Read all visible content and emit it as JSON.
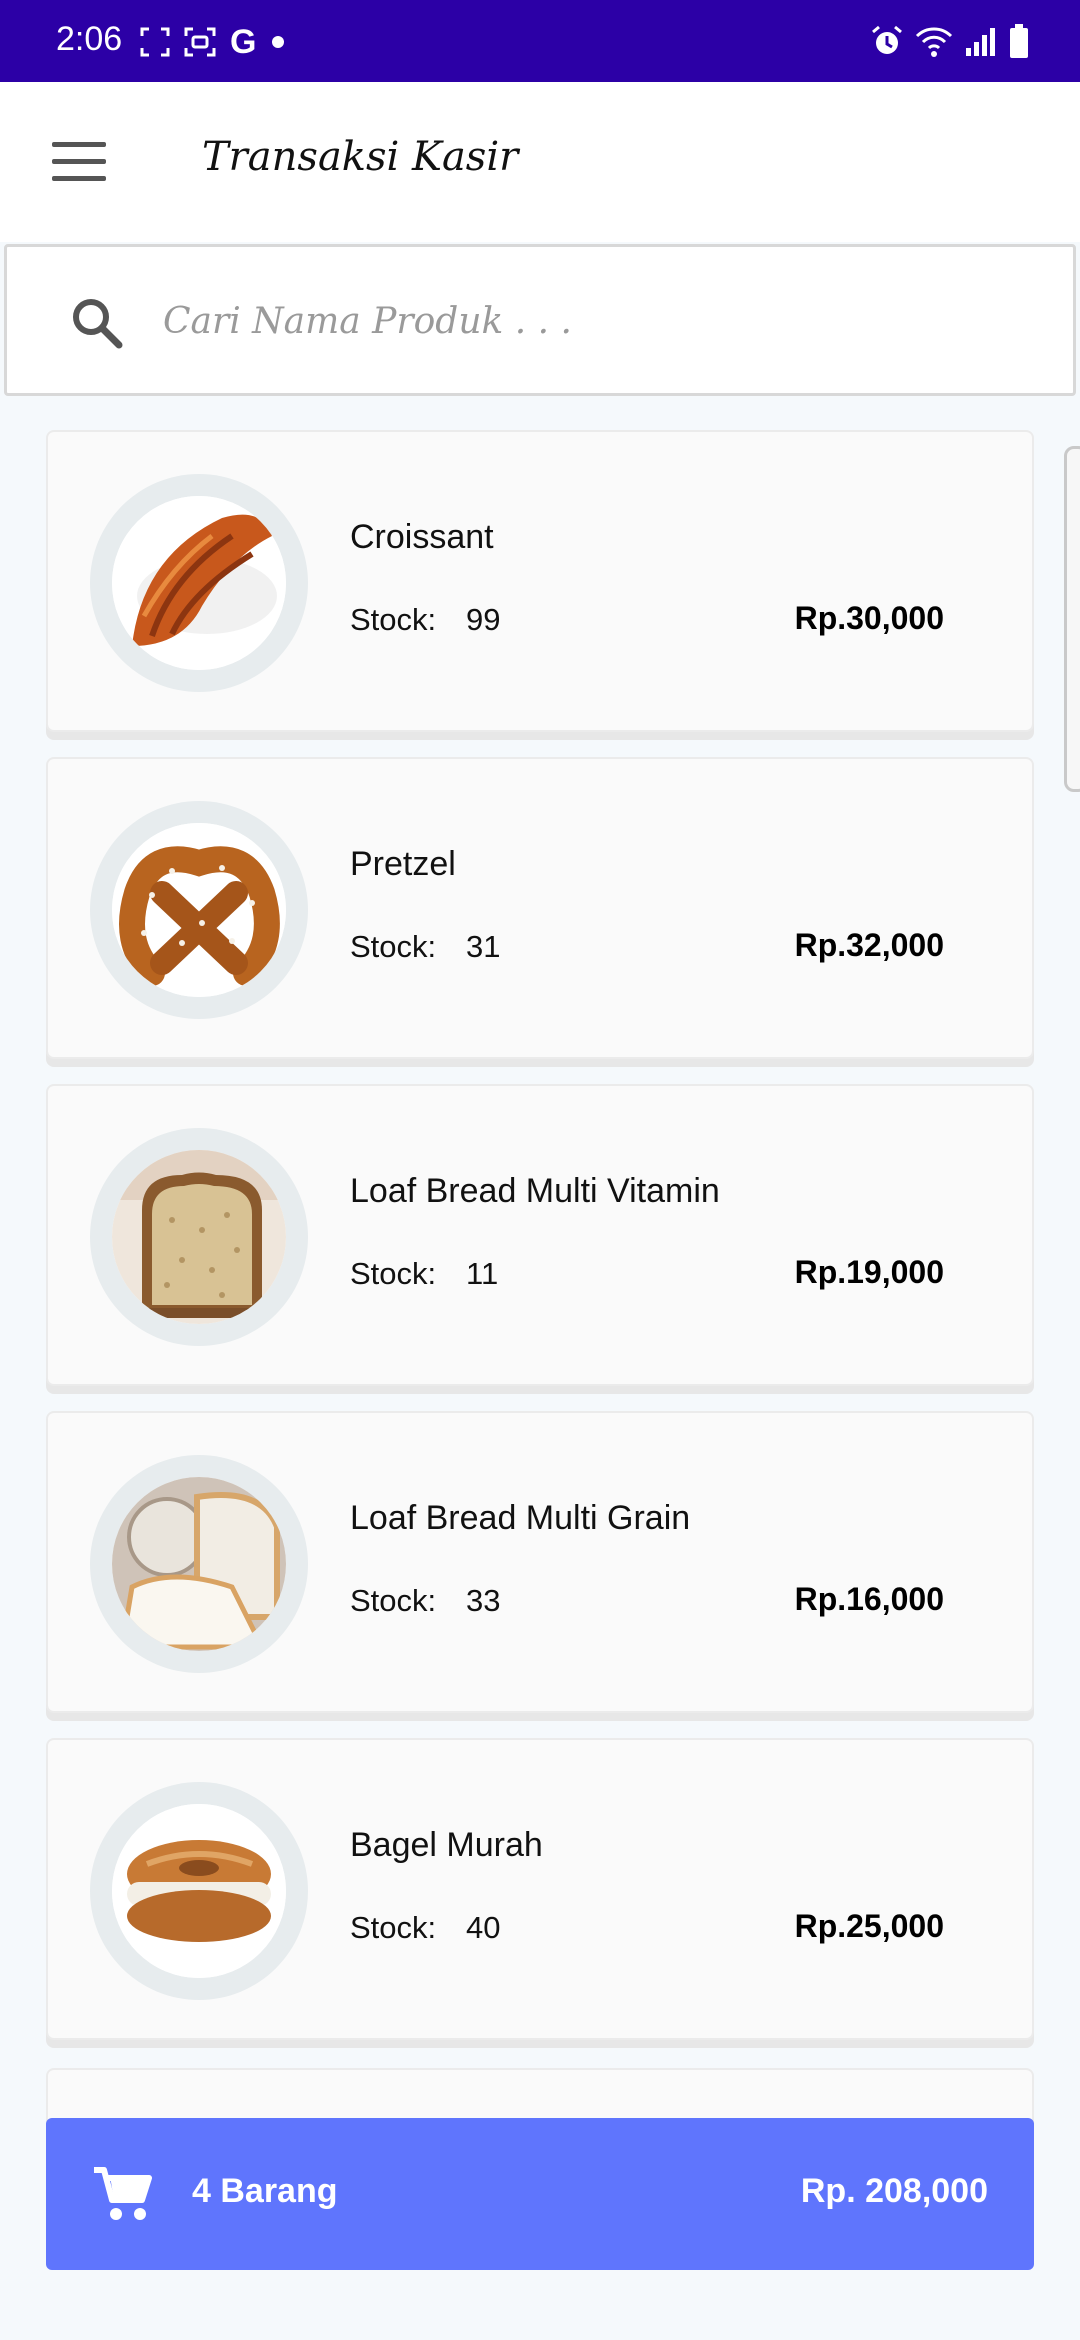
{
  "status_bar": {
    "time": "2:06",
    "left_icons": [
      "screenshot-frame-icon",
      "scan-icon",
      "google-g-icon",
      "dot-icon"
    ],
    "right_icons": [
      "alarm-icon",
      "wifi-icon",
      "signal-icon",
      "battery-icon"
    ],
    "g_letter": "G",
    "background_color": "#2c00a6"
  },
  "app_bar": {
    "title": "Transaksi Kasir",
    "menu_icon": "hamburger-menu-icon"
  },
  "search": {
    "placeholder": "Cari Nama Produk . . .",
    "value": "",
    "icon": "search-icon"
  },
  "products": [
    {
      "name": "Croissant",
      "stock_label": "Stock:",
      "stock": "99",
      "price": "Rp.30,000",
      "image": "croissant"
    },
    {
      "name": "Pretzel",
      "stock_label": "Stock:",
      "stock": "31",
      "price": "Rp.32,000",
      "image": "pretzel"
    },
    {
      "name": "Loaf Bread Multi Vitamin",
      "stock_label": "Stock:",
      "stock": "11",
      "price": "Rp.19,000",
      "image": "loaf-bread"
    },
    {
      "name": "Loaf Bread Multi Grain",
      "stock_label": "Stock:",
      "stock": "33",
      "price": "Rp.16,000",
      "image": "white-bread"
    },
    {
      "name": "Bagel Murah",
      "stock_label": "Stock:",
      "stock": "40",
      "price": "Rp.25,000",
      "image": "bagel"
    }
  ],
  "cart": {
    "count_label": "4 Barang",
    "total": "Rp. 208,000",
    "icon": "shopping-cart-icon",
    "background_color": "#5f75fd"
  }
}
